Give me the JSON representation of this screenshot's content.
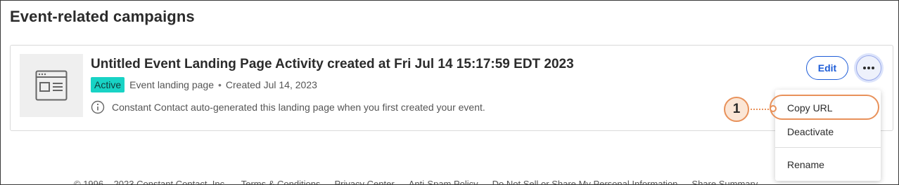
{
  "section": {
    "title": "Event-related campaigns"
  },
  "campaign": {
    "thumbnail_icon": "landing-page-icon",
    "title": "Untitled Event Landing Page Activity created at Fri Jul 14 15:17:59 EDT 2023",
    "status": "Active",
    "type": "Event landing page",
    "separator": "•",
    "created": "Created Jul 14, 2023",
    "note_icon": "info-icon",
    "note": "Constant Contact auto-generated this landing page when you first created your event.",
    "edit_label": "Edit",
    "more_icon": "ellipsis-icon"
  },
  "menu": {
    "items": [
      "Copy URL",
      "Deactivate",
      "Rename"
    ]
  },
  "callout": {
    "number": "1"
  },
  "footer": {
    "links": [
      "© 1996 – 2023 Constant Contact, Inc.",
      "Terms & Conditions",
      "Privacy Center",
      "Anti-Spam Policy",
      "Do Not Sell or Share My Personal Information",
      "Share Summary"
    ]
  },
  "colors": {
    "badge": "#18d3c5",
    "accent": "#1d5cd7",
    "callout": "#e8915a"
  }
}
